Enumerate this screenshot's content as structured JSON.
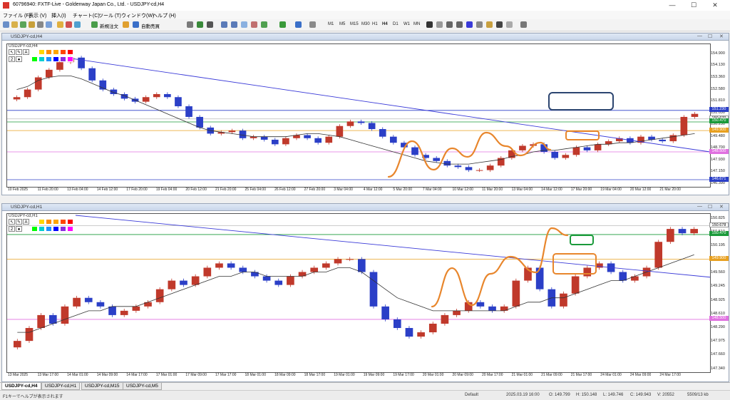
{
  "window": {
    "title": "60796940: FXTF-Live - Goldenway Japan Co., Ltd. - USDJPY-cd,H4",
    "minimize": "—",
    "maximize": "☐",
    "close": "✕"
  },
  "menu": [
    "ファイル (F)",
    "表示 (V)",
    "挿入(I)",
    "チャート(C)",
    "ツール (T)",
    "ウィンドウ(W)",
    "ヘルプ (H)"
  ],
  "toolbar": {
    "new_order": "新規注文",
    "auto_trade": "自動売買",
    "timeframes": [
      "M1",
      "M5",
      "M15",
      "M30",
      "H1",
      "H4",
      "D1",
      "W1",
      "MN"
    ]
  },
  "colors": {
    "bull": "#c0392b",
    "bear": "#2b3fc7",
    "trend": "#3a3ad8",
    "ma": "#333333",
    "orange": "#e8862c",
    "green": "#1a9a3a",
    "navy": "#2c4570",
    "magenta": "#e070e0",
    "yellow": "#e8a020"
  },
  "palette_colors": [
    "#ffffff",
    "#ffd700",
    "#ff8c00",
    "#ffa500",
    "#ff4500",
    "#ff0000",
    "#00ff00",
    "#00ced1",
    "#1e90ff",
    "#0000ff",
    "#8a2be2",
    "#ff00ff"
  ],
  "palette_tools": [
    "↖",
    "✎",
    "A",
    "2",
    "●"
  ],
  "chart_data": [
    {
      "type": "candlestick",
      "window_title": "USDJPY-cd,H4",
      "plot_label": "USDJPY-cd,H4",
      "ylim": [
        146.39,
        155.3
      ],
      "y_ticks": [
        154.9,
        154.13,
        153.36,
        152.58,
        151.81,
        151.03,
        150.25,
        149.48,
        148.7,
        147.93,
        147.15,
        146.39
      ],
      "x_ticks": [
        "10 Feb 2025",
        "11 Feb 20:00",
        "13 Feb 04:00",
        "14 Feb 12:00",
        "17 Feb 20:00",
        "19 Feb 04:00",
        "20 Feb 12:00",
        "21 Feb 20:00",
        "25 Feb 04:00",
        "26 Feb 12:00",
        "27 Feb 20:00",
        "3 Mar 04:00",
        "4 Mar 12:00",
        "5 Mar 20:00",
        "7 Mar 04:00",
        "10 Mar 12:00",
        "11 Mar 20:00",
        "13 Mar 04:00",
        "14 Mar 12:00",
        "17 Mar 20:00",
        "19 Mar 04:00",
        "20 Mar 12:00",
        "21 Mar 20:00"
      ],
      "price_levels": [
        {
          "value": 151.23,
          "label": "151.230",
          "color": "#2b3fc7"
        },
        {
          "value": 150.67,
          "label": "150.670",
          "color": "#ffffff"
        },
        {
          "value": 150.47,
          "label": "150.470",
          "color": "#1a9a3a"
        },
        {
          "value": 149.9,
          "label": "149.900",
          "color": "#e8a020"
        },
        {
          "value": 148.5,
          "label": "148.500",
          "color": "#e070e0"
        },
        {
          "value": 146.67,
          "label": "146.671",
          "color": "#2b3fc7"
        }
      ],
      "close_series": [
        152.1,
        152.6,
        153.4,
        153.9,
        154.4,
        154.7,
        154.0,
        153.2,
        152.6,
        152.3,
        152.0,
        151.8,
        152.1,
        152.3,
        152.1,
        151.5,
        150.8,
        150.1,
        149.7,
        149.8,
        149.9,
        149.4,
        149.5,
        149.3,
        149.0,
        149.4,
        149.6,
        149.4,
        149.1,
        149.5,
        150.2,
        150.5,
        150.4,
        150.0,
        149.5,
        149.1,
        148.8,
        148.3,
        148.1,
        147.9,
        147.6,
        147.5,
        147.3,
        147.3,
        147.6,
        148.1,
        148.6,
        148.9,
        149.0,
        148.5,
        148.1,
        148.3,
        148.8,
        148.6,
        149.0,
        149.2,
        149.4,
        149.1,
        149.5,
        149.3,
        149.2,
        149.6,
        150.8,
        151.0
      ],
      "ma_series": [
        152.6,
        152.8,
        153.2,
        153.4,
        153.5,
        153.5,
        153.3,
        153.0,
        152.7,
        152.4,
        152.2,
        151.9,
        151.6,
        151.3,
        151.0,
        150.7,
        150.4,
        150.1,
        149.9,
        149.8,
        149.7,
        149.6,
        149.5,
        149.5,
        149.5,
        149.5,
        149.6,
        149.7,
        149.7,
        149.6,
        149.5,
        149.3,
        149.1,
        148.9,
        148.7,
        148.5,
        148.3,
        148.1,
        147.9,
        147.8,
        147.7,
        147.7,
        147.7,
        147.8,
        147.9,
        148.0,
        148.2,
        148.3,
        148.5,
        148.6,
        148.6,
        148.7,
        148.8,
        148.9,
        149.0,
        149.0,
        149.1,
        149.1,
        149.2,
        149.3,
        149.4,
        149.5,
        149.6,
        149.7
      ]
    },
    {
      "type": "candlestick",
      "window_title": "USDJPY-cd,H1",
      "plot_label": "USDJPY-cd,H1",
      "ylim": [
        147.34,
        150.85
      ],
      "y_ticks": [
        150.825,
        150.51,
        150.195,
        149.875,
        149.56,
        149.245,
        148.925,
        148.61,
        148.29,
        147.975,
        147.66,
        147.34
      ],
      "x_ticks": [
        "13 Mar 2025",
        "13 Mar 17:00",
        "14 Mar 01:00",
        "14 Mar 09:00",
        "14 Mar 17:00",
        "17 Mar 01:00",
        "17 Mar 09:00",
        "17 Mar 17:00",
        "18 Mar 01:00",
        "18 Mar 09:00",
        "18 Mar 17:00",
        "19 Mar 01:00",
        "19 Mar 09:00",
        "19 Mar 17:00",
        "20 Mar 01:00",
        "20 Mar 09:00",
        "20 Mar 17:00",
        "21 Mar 01:00",
        "21 Mar 09:00",
        "21 Mar 17:00",
        "24 Mar 01:00",
        "24 Mar 09:00",
        "24 Mar 17:00"
      ],
      "price_levels": [
        {
          "value": 150.678,
          "label": "150.678",
          "color": "#ffffff"
        },
        {
          "value": 150.47,
          "label": "150.470",
          "color": "#1a9a3a"
        },
        {
          "value": 149.9,
          "label": "149.900",
          "color": "#e8a020"
        },
        {
          "value": 148.5,
          "label": "148.500",
          "color": "#e070e0"
        }
      ],
      "close_series": [
        148.0,
        148.3,
        148.6,
        148.4,
        148.8,
        149.0,
        148.9,
        148.8,
        148.6,
        148.7,
        148.8,
        148.9,
        149.2,
        149.4,
        149.3,
        149.5,
        149.7,
        149.8,
        149.7,
        149.6,
        149.5,
        149.4,
        149.3,
        149.5,
        149.6,
        149.7,
        149.8,
        149.9,
        149.9,
        149.6,
        148.8,
        148.5,
        148.3,
        148.1,
        148.2,
        148.4,
        148.6,
        148.7,
        148.9,
        148.8,
        148.7,
        148.8,
        149.4,
        149.7,
        149.2,
        148.8,
        149.1,
        149.5,
        149.7,
        149.8,
        149.6,
        149.4,
        149.5,
        149.7,
        150.3,
        150.6,
        150.5,
        150.6
      ],
      "ma_series": [
        148.2,
        148.2,
        148.3,
        148.4,
        148.5,
        148.6,
        148.7,
        148.7,
        148.8,
        148.8,
        148.8,
        148.9,
        149.0,
        149.1,
        149.2,
        149.3,
        149.4,
        149.5,
        149.5,
        149.6,
        149.6,
        149.5,
        149.5,
        149.5,
        149.5,
        149.6,
        149.6,
        149.7,
        149.7,
        149.6,
        149.4,
        149.2,
        149.0,
        148.9,
        148.8,
        148.7,
        148.7,
        148.7,
        148.7,
        148.7,
        148.7,
        148.7,
        148.8,
        148.9,
        148.9,
        149.0,
        149.0,
        149.1,
        149.2,
        149.3,
        149.4,
        149.4,
        149.5,
        149.6,
        149.7,
        149.8,
        149.9,
        150.0
      ]
    }
  ],
  "tabs": [
    "USDJPY-cd,H4",
    "USDJPY-cd,H1",
    "USDJPY-cd,M15",
    "USDJPY-cd,M5"
  ],
  "status": {
    "help": "F1キーでヘルプが表示されます",
    "profile": "Default",
    "datetime": "2025.03.19 16:00",
    "open": "O: 149.799",
    "high": "H: 150.148",
    "low": "L: 149.746",
    "close": "C: 149.943",
    "volume": "V: 20552",
    "traffic": "5509/13 kb"
  }
}
